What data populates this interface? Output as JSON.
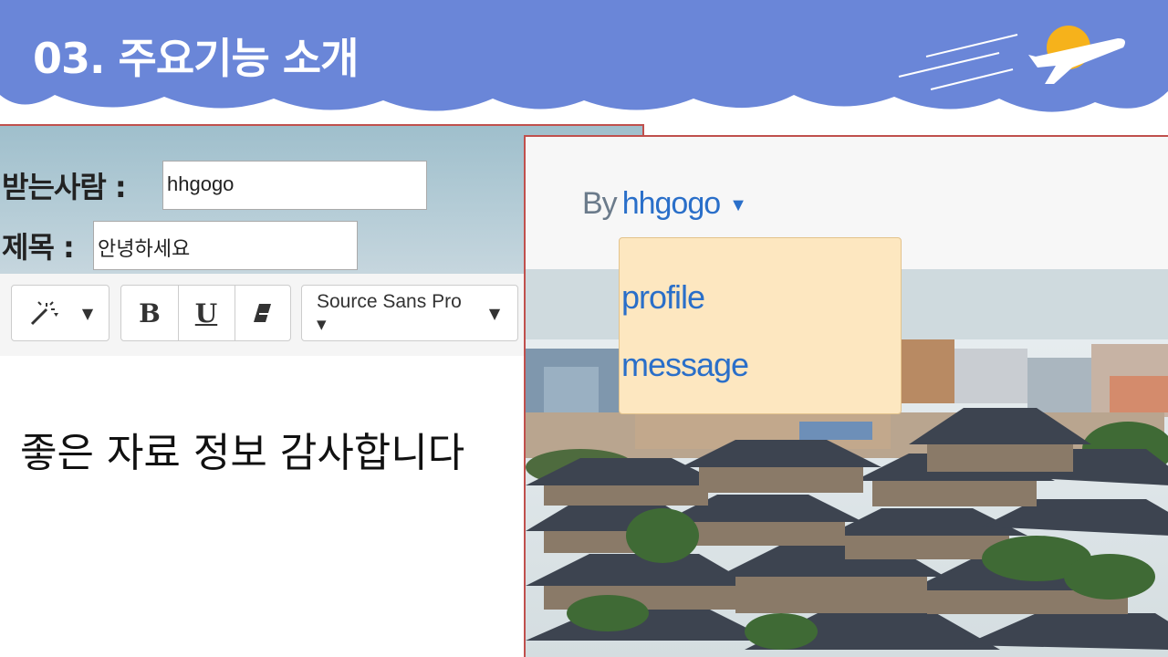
{
  "slide": {
    "title": "03. 주요기능 소개",
    "colors": {
      "banner": "#6a86d8",
      "panel_border": "#c0504d",
      "sun": "#f6b21b"
    }
  },
  "composer": {
    "recipient_label": "받는사람 :",
    "recipient_value": "hhgogo",
    "subject_label": "제목 :",
    "subject_value": "안녕하세요",
    "toolbar": {
      "style_icon": "magic-wand-icon",
      "bold_label": "B",
      "underline_label": "U",
      "eraser_icon": "eraser-icon",
      "font_select": "Source Sans Pro ▾",
      "caret": "▼"
    },
    "body_text": "좋은 자료 정보 감사합니다"
  },
  "user_page": {
    "by_label": "By",
    "username": "hhgogo",
    "caret": "▼",
    "menu": [
      "profile",
      "message"
    ],
    "colors": {
      "link": "#2a6fc9",
      "menu_bg": "#fde7c0"
    }
  }
}
